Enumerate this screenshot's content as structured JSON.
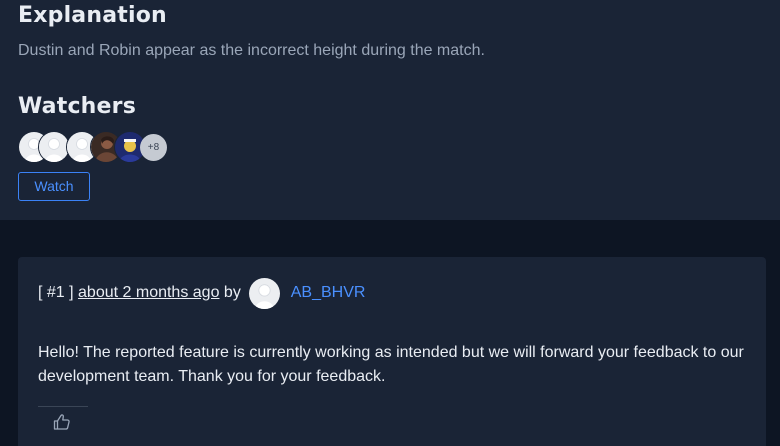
{
  "explanation": {
    "title": "Explanation",
    "text": "Dustin and Robin appear as the incorrect height during the match."
  },
  "watchers": {
    "title": "Watchers",
    "avatars": [
      "default-avatar",
      "default-avatar",
      "default-avatar",
      "character-portrait-avatar",
      "character-portrait-avatar"
    ],
    "extra_count": "+8",
    "watch_label": "Watch"
  },
  "comment": {
    "number": "[ #1 ]",
    "time": "about 2 months ago",
    "by": "by",
    "author": "AB_BHVR",
    "body": "Hello! The reported feature is currently working as intended but we will forward your feedback to our development team. Thank you for your feedback.",
    "like_icon": "thumbs-up-icon"
  },
  "colors": {
    "panel": "#1a2436",
    "page": "#0d1523",
    "accent": "#3b82f6"
  }
}
